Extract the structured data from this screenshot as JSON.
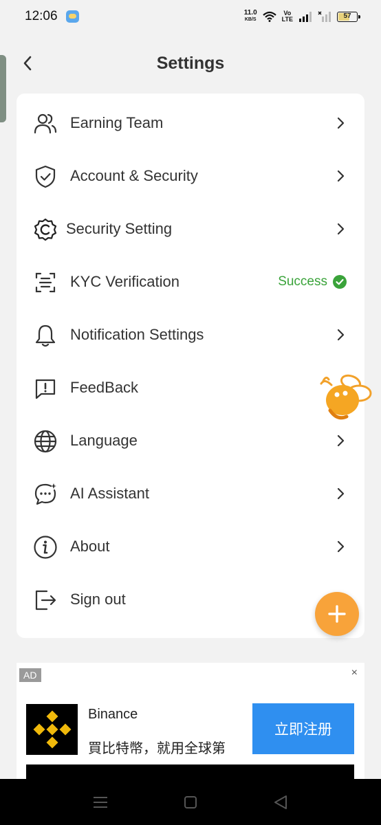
{
  "status_bar": {
    "time": "12:06",
    "net_speed": "11.0",
    "net_speed_unit": "KB/S",
    "volte_top": "Vo",
    "volte_bottom": "LTE",
    "battery": "57"
  },
  "header": {
    "title": "Settings"
  },
  "menu": [
    {
      "label": "Earning Team",
      "icon": "team-icon"
    },
    {
      "label": "Account & Security",
      "icon": "shield-icon"
    },
    {
      "label": "Security Setting",
      "icon": "gear-icon"
    },
    {
      "label": "KYC Verification",
      "icon": "scan-icon",
      "status": "Success"
    },
    {
      "label": "Notification Settings",
      "icon": "bell-icon"
    },
    {
      "label": "FeedBack",
      "icon": "feedback-icon"
    },
    {
      "label": "Language",
      "icon": "globe-icon"
    },
    {
      "label": "AI Assistant",
      "icon": "chat-icon"
    },
    {
      "label": "About",
      "icon": "info-icon"
    },
    {
      "label": "Sign out",
      "icon": "sign-out-icon"
    }
  ],
  "ad": {
    "badge": "AD",
    "close": "×",
    "name": "Binance",
    "description": "買比特幣，就用全球第",
    "cta": "立即注册"
  },
  "colors": {
    "accent": "#f8a33a",
    "success": "#3aa33a",
    "cta_blue": "#2f8ff0",
    "binance_yellow": "#f0b90b"
  }
}
